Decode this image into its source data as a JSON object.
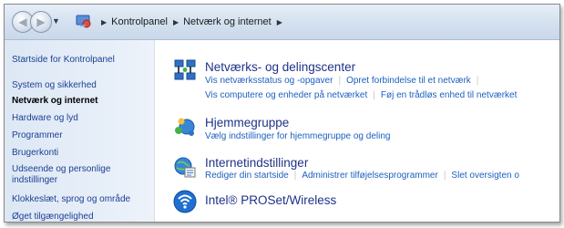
{
  "breadcrumb": {
    "items": [
      "Kontrolpanel",
      "Netværk og internet"
    ]
  },
  "sidebar": {
    "items": [
      {
        "label": "Startside for Kontrolpanel",
        "active": false
      },
      {
        "label": "System og sikkerhed",
        "active": false
      },
      {
        "label": "Netværk og internet",
        "active": true
      },
      {
        "label": "Hardware og lyd",
        "active": false
      },
      {
        "label": "Programmer",
        "active": false
      },
      {
        "label": "Brugerkonti",
        "active": false
      },
      {
        "label": "Udseende og personlige indstillinger",
        "active": false
      },
      {
        "label": "Klokkeslæt, sprog og område",
        "active": false
      },
      {
        "label": "Øget tilgængelighed",
        "active": false
      }
    ]
  },
  "categories": [
    {
      "title": "Netværks- og delingscenter",
      "icon": "network-sharing-center-icon",
      "links_row1": [
        "Vis netværksstatus og -opgaver",
        "Opret forbindelse til et netværk"
      ],
      "links_row2": [
        "Vis computere og enheder på netværket",
        "Føj en trådløs enhed til netværket"
      ]
    },
    {
      "title": "Hjemmegruppe",
      "icon": "homegroup-icon",
      "links_row1": [
        "Vælg indstillinger for hjemmegruppe og deling"
      ]
    },
    {
      "title": "Internetindstillinger",
      "icon": "internet-options-icon",
      "links_row1": [
        "Rediger din startside",
        "Administrer tilføjelsesprogrammer",
        "Slet oversigten o"
      ]
    },
    {
      "title": "Intel® PROSet/Wireless",
      "icon": "wireless-icon"
    }
  ],
  "colors": {
    "link": "#1d5fbf",
    "category_title": "#1e3287",
    "sidebar_link": "#1c3f94"
  }
}
